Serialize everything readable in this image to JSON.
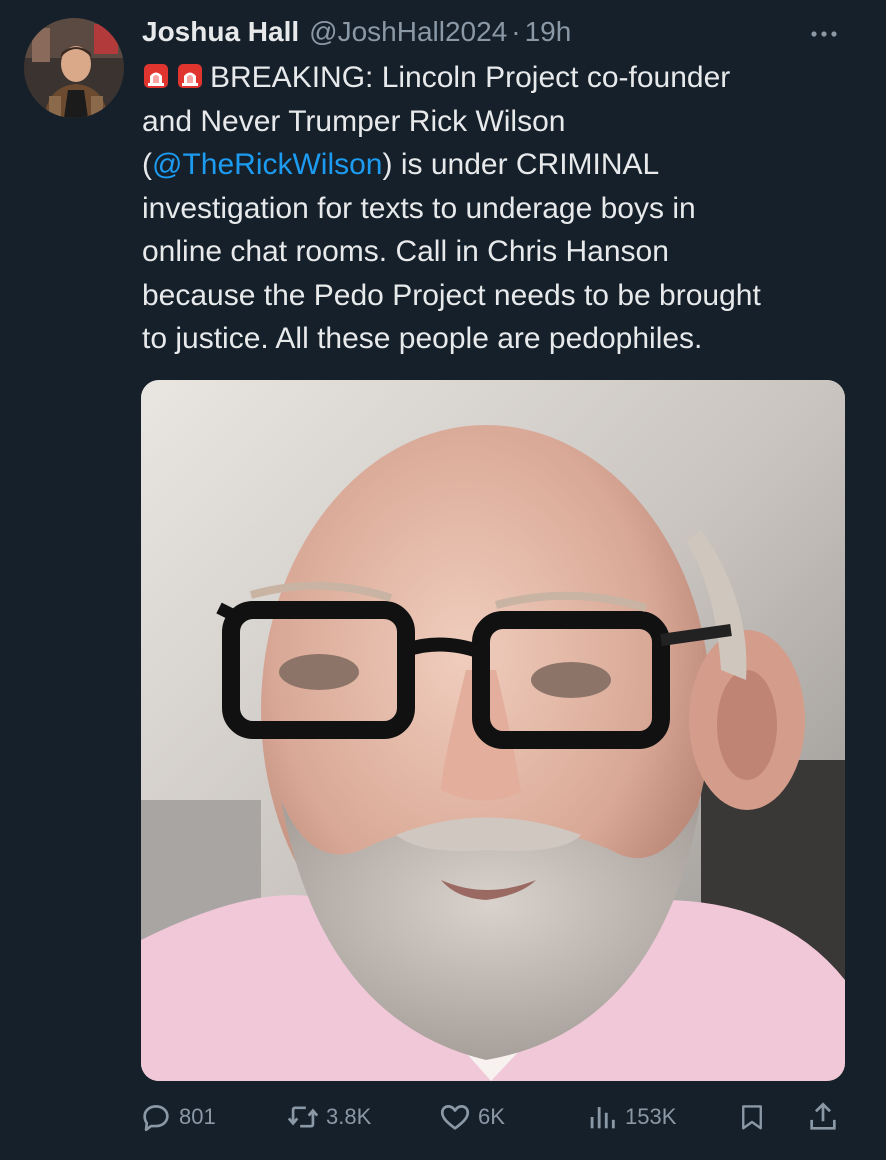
{
  "author": {
    "name": "Joshua Hall",
    "handle": "@JoshHall2024",
    "separator": "·",
    "time": "19h",
    "avatar_icon": "profile-photo"
  },
  "tweet": {
    "lines": [
      {
        "prefix": "BREAKING: Lincoln Project co-founder"
      },
      {
        "text": "and Never Trumper Rick Wilson"
      },
      {
        "open": "(",
        "mention": "@TheRickWilson",
        "after": ") is under CRIMINAL"
      },
      {
        "text": "investigation for texts to underage boys in"
      },
      {
        "text": "online chat rooms. Call in Chris Hanson"
      },
      {
        "text": "because the Pedo Project needs to be brought"
      },
      {
        "text": "to justice. All these people are pedophiles."
      }
    ],
    "emoji": [
      "police-siren-icon",
      "police-siren-icon"
    ]
  },
  "media": {
    "type": "photo",
    "description_icon": "portrait-photo"
  },
  "actions": {
    "reply": {
      "icon": "reply-icon",
      "count": "801"
    },
    "retweet": {
      "icon": "retweet-icon",
      "count": "3.8K"
    },
    "like": {
      "icon": "heart-icon",
      "count": "6K"
    },
    "views": {
      "icon": "analytics-icon",
      "count": "153K"
    },
    "bookmark": {
      "icon": "bookmark-icon"
    },
    "share": {
      "icon": "share-icon"
    }
  },
  "colors": {
    "background": "#15202b",
    "text": "#e7e9ea",
    "secondary": "#8b98a5",
    "link": "#1d9bf0"
  }
}
